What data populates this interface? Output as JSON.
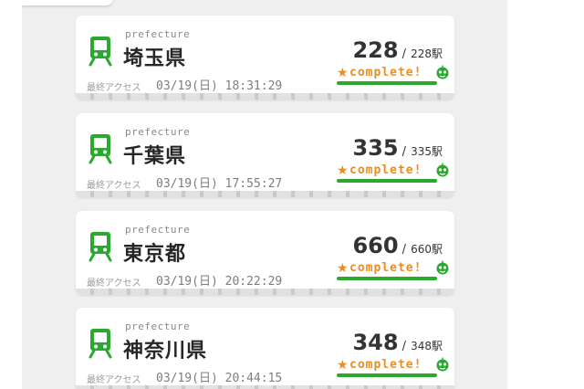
{
  "colors": {
    "accent_green": "#2aa92e",
    "complete_orange": "#ee8b1a",
    "panel_bg": "#efefef"
  },
  "icons": {
    "train": "train-icon",
    "star": "star-icon",
    "mascot": "mascot-icon"
  },
  "prefectures": [
    {
      "tag": "prefecture",
      "name": "埼玉県",
      "access_label": "最終アクセス",
      "access_time": "03/19(日) 18:31:29",
      "visited": "228",
      "sep": "/",
      "total": "228",
      "unit": "駅",
      "status": "complete!",
      "progress": 1.0
    },
    {
      "tag": "prefecture",
      "name": "千葉県",
      "access_label": "最終アクセス",
      "access_time": "03/19(日) 17:55:27",
      "visited": "335",
      "sep": "/",
      "total": "335",
      "unit": "駅",
      "status": "complete!",
      "progress": 1.0
    },
    {
      "tag": "prefecture",
      "name": "東京都",
      "access_label": "最終アクセス",
      "access_time": "03/19(日) 20:22:29",
      "visited": "660",
      "sep": "/",
      "total": "660",
      "unit": "駅",
      "status": "complete!",
      "progress": 1.0
    },
    {
      "tag": "prefecture",
      "name": "神奈川県",
      "access_label": "最終アクセス",
      "access_time": "03/19(日) 20:44:15",
      "visited": "348",
      "sep": "/",
      "total": "348",
      "unit": "駅",
      "status": "complete!",
      "progress": 1.0
    }
  ]
}
